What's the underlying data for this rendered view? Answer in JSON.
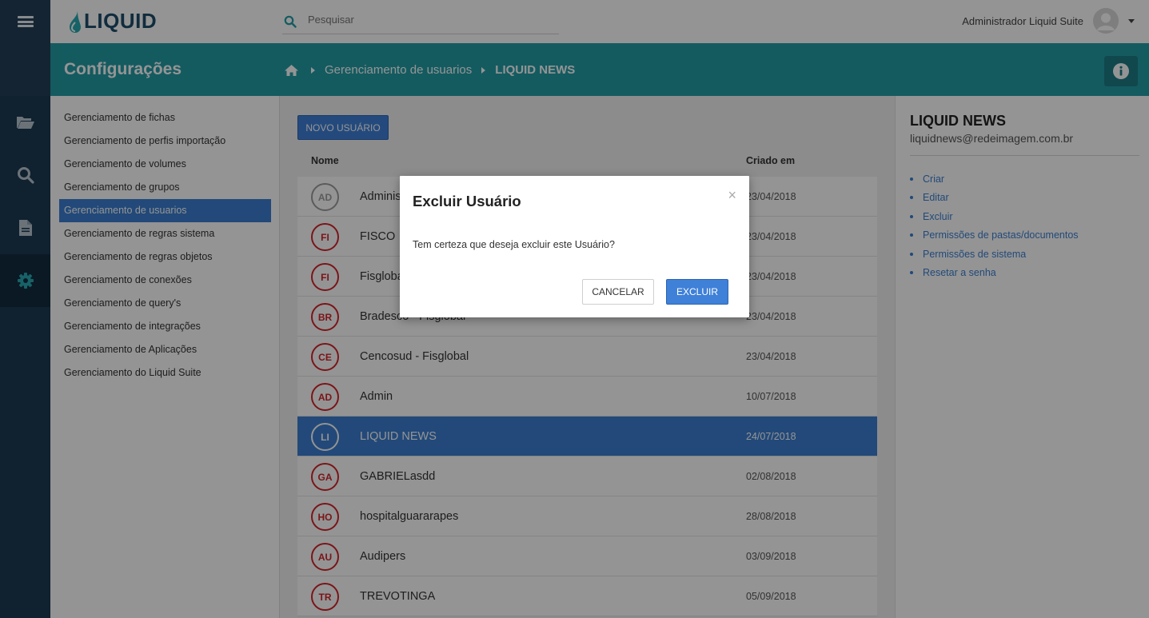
{
  "app": {
    "logo_text": "LIQUID"
  },
  "search": {
    "placeholder": "Pesquisar"
  },
  "user": {
    "name": "Administrador Liquid Suite"
  },
  "titlebar": {
    "title": "Configurações",
    "breadcrumb": [
      "Gerenciamento de usuarios",
      "LIQUID NEWS"
    ]
  },
  "rail": {
    "icons": [
      "menu-icon",
      "folder-open-icon",
      "search-icon",
      "document-icon",
      "gear-icon"
    ],
    "active": "gear-icon"
  },
  "settings_nav": {
    "items": [
      {
        "label": "Gerenciamento de fichas"
      },
      {
        "label": "Gerenciamento de perfis importação"
      },
      {
        "label": "Gerenciamento de volumes"
      },
      {
        "label": "Gerenciamento de grupos"
      },
      {
        "label": "Gerenciamento de usuarios"
      },
      {
        "label": "Gerenciamento de regras sistema"
      },
      {
        "label": "Gerenciamento de regras objetos"
      },
      {
        "label": "Gerenciamento de conexões"
      },
      {
        "label": "Gerenciamento de query's"
      },
      {
        "label": "Gerenciamento de integrações"
      },
      {
        "label": "Gerenciamento de Aplicações"
      },
      {
        "label": "Gerenciamento do Liquid Suite"
      }
    ],
    "selected_index": 4
  },
  "main": {
    "new_user_label": "NOVO USUÁRIO",
    "columns": {
      "name": "Nome",
      "created": "Criado em"
    },
    "rows": [
      {
        "initials": "AD",
        "name": "Administrador",
        "created": "23/04/2018"
      },
      {
        "initials": "FI",
        "name": "FISCO",
        "created": "23/04/2018"
      },
      {
        "initials": "FI",
        "name": "Fisglobal",
        "created": "23/04/2018"
      },
      {
        "initials": "BR",
        "name": "Bradesco - Fisglobal",
        "created": "23/04/2018"
      },
      {
        "initials": "CE",
        "name": "Cencosud - Fisglobal",
        "created": "23/04/2018"
      },
      {
        "initials": "AD",
        "name": "Admin",
        "created": "10/07/2018"
      },
      {
        "initials": "LI",
        "name": "LIQUID NEWS",
        "created": "24/07/2018"
      },
      {
        "initials": "GA",
        "name": "GABRIELasdd",
        "created": "02/08/2018"
      },
      {
        "initials": "HO",
        "name": "hospitalguararapes",
        "created": "28/08/2018"
      },
      {
        "initials": "AU",
        "name": "Audipers",
        "created": "03/09/2018"
      },
      {
        "initials": "TR",
        "name": "TREVOTINGA",
        "created": "05/09/2018"
      }
    ],
    "selected_index": 6
  },
  "detail": {
    "title": "LIQUID NEWS",
    "email": "liquidnews@redeimagem.com.br",
    "actions": [
      {
        "label": "Criar"
      },
      {
        "label": "Editar"
      },
      {
        "label": "Excluir"
      },
      {
        "label": "Permissões de pastas/documentos"
      },
      {
        "label": "Permissões de sistema"
      },
      {
        "label": "Resetar a senha"
      }
    ]
  },
  "modal": {
    "title": "Excluir Usuário",
    "close": "×",
    "message": "Tem certeza que deseja excluir este Usuário?",
    "cancel_label": "CANCELAR",
    "confirm_label": "EXCLUIR"
  },
  "colors": {
    "rail": "#1d3a52",
    "teal": "#239ea6",
    "accent_blue": "#3b7fd1",
    "badge_red": "#d4242a"
  }
}
